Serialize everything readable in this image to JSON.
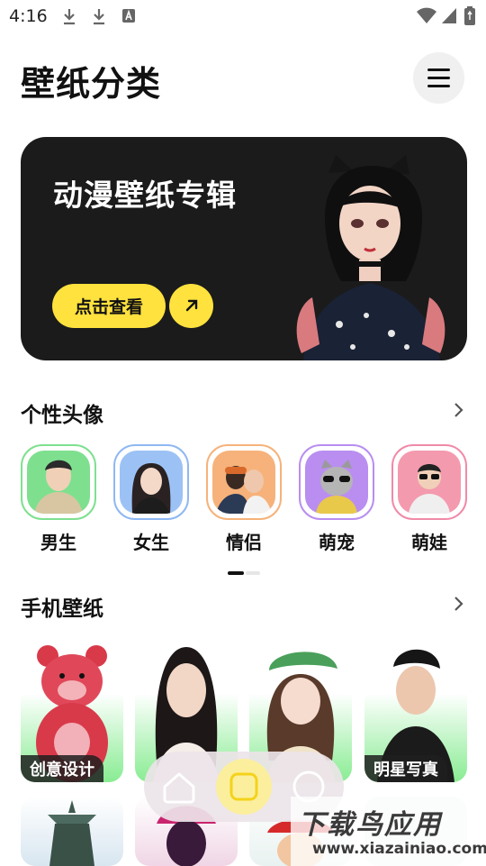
{
  "status": {
    "time": "4:16"
  },
  "header": {
    "title": "壁纸分类"
  },
  "banner": {
    "title": "动漫壁纸专辑",
    "button_label": "点击查看"
  },
  "avatars_section": {
    "title": "个性头像",
    "items": [
      {
        "label": "男生",
        "color": "#7ee08f"
      },
      {
        "label": "女生",
        "color": "#8fb8f2"
      },
      {
        "label": "情侣",
        "color": "#f6b27a"
      },
      {
        "label": "萌宠",
        "color": "#b98ef0"
      },
      {
        "label": "萌娃",
        "color": "#f08aa8"
      }
    ]
  },
  "wallpapers_section": {
    "title": "手机壁纸",
    "items": [
      {
        "label": "创意设计"
      },
      {
        "label": ""
      },
      {
        "label": ""
      },
      {
        "label": "明星写真"
      }
    ]
  },
  "watermark": {
    "text": "下载鸟应用",
    "url": "www.xiazainiao.com"
  },
  "colors": {
    "accent": "#ffe23e",
    "banner_bg": "#1b1b1b"
  }
}
